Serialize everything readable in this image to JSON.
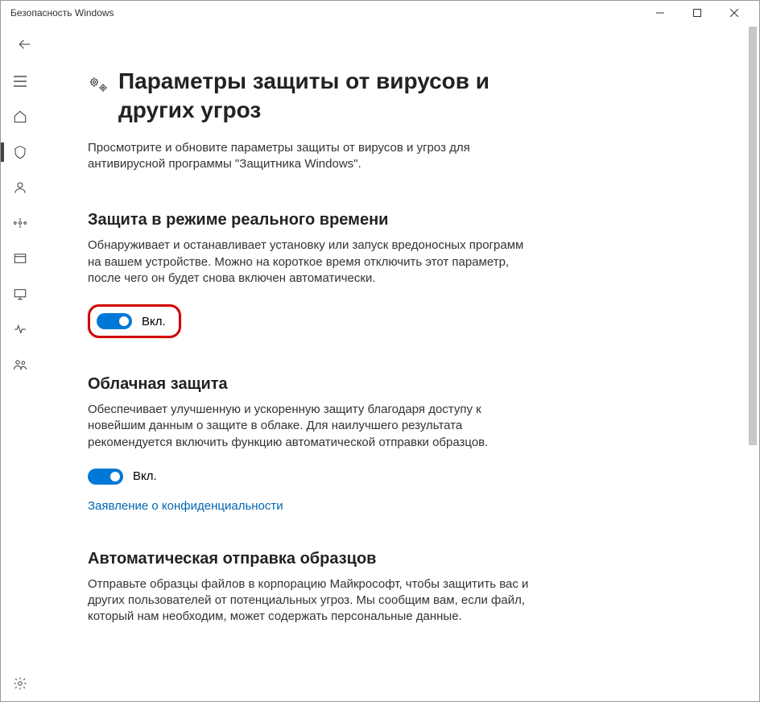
{
  "window": {
    "title": "Безопасность Windows"
  },
  "page": {
    "heading": "Параметры защиты от вирусов и других угроз",
    "subheading": "Просмотрите и обновите параметры защиты от вирусов и угроз для антивирусной программы \"Защитника Windows\"."
  },
  "sections": {
    "realtime": {
      "title": "Защита в режиме реального времени",
      "desc": "Обнаруживает и останавливает установку или запуск вредоносных программ на вашем устройстве. Можно на короткое время отключить этот параметр, после чего он будет снова включен автоматически.",
      "toggle_label": "Вкл."
    },
    "cloud": {
      "title": "Облачная защита",
      "desc": "Обеспечивает улучшенную и ускоренную защиту благодаря доступу к новейшим данным о защите в облаке. Для наилучшего результата рекомендуется включить функцию автоматической отправки образцов.",
      "toggle_label": "Вкл.",
      "link": "Заявление о конфиденциальности"
    },
    "samples": {
      "title": "Автоматическая отправка образцов",
      "desc": "Отправьте образцы файлов в корпорацию Майкрософт, чтобы защитить вас и других пользователей от потенциальных угроз. Мы сообщим вам, если файл, который нам необходим, может содержать персональные данные."
    }
  }
}
